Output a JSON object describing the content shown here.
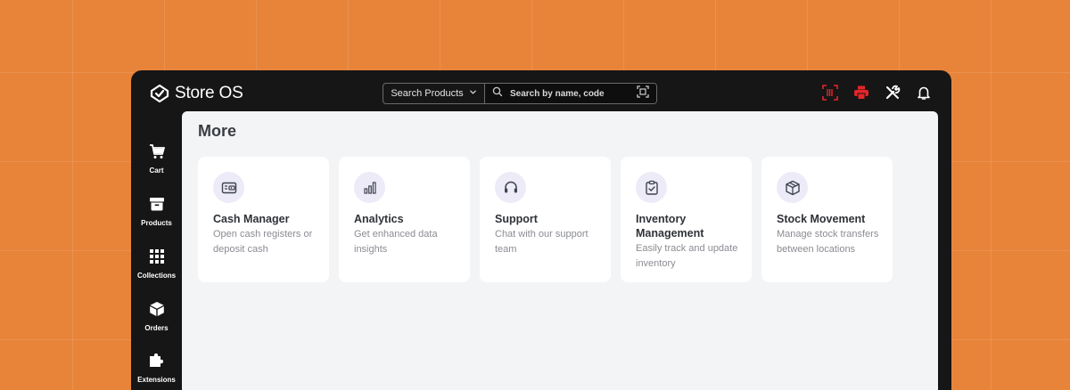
{
  "app": {
    "name": "Store OS"
  },
  "search": {
    "mode_label": "Search Products",
    "placeholder": "Search by name, code"
  },
  "topbar_icons": [
    "barcode-scanner-icon",
    "printer-icon",
    "tools-icon",
    "bell-icon"
  ],
  "sidebar": {
    "items": [
      {
        "label": "Cart",
        "icon": "cart-icon"
      },
      {
        "label": "Products",
        "icon": "archive-box-icon"
      },
      {
        "label": "Collections",
        "icon": "grid-icon"
      },
      {
        "label": "Orders",
        "icon": "box-icon"
      },
      {
        "label": "Extensions",
        "icon": "puzzle-icon"
      }
    ]
  },
  "main": {
    "title": "More",
    "cards": [
      {
        "title": "Cash Manager",
        "description": "Open cash registers or deposit cash",
        "icon": "cash-register-icon"
      },
      {
        "title": "Analytics",
        "description": "Get enhanced data insights",
        "icon": "bar-chart-icon"
      },
      {
        "title": "Support",
        "description": "Chat with our support team",
        "icon": "headset-icon"
      },
      {
        "title": "Inventory Management",
        "description": "Easily track and update inventory",
        "icon": "clipboard-check-icon"
      },
      {
        "title": "Stock Movement",
        "description": "Manage stock transfers between locations",
        "icon": "package-icon"
      }
    ]
  },
  "colors": {
    "background": "#E8843A",
    "window": "#161616",
    "content": "#F3F4F6",
    "alert_red": "#E5252A",
    "icon_accent": "#ECEBF7"
  }
}
